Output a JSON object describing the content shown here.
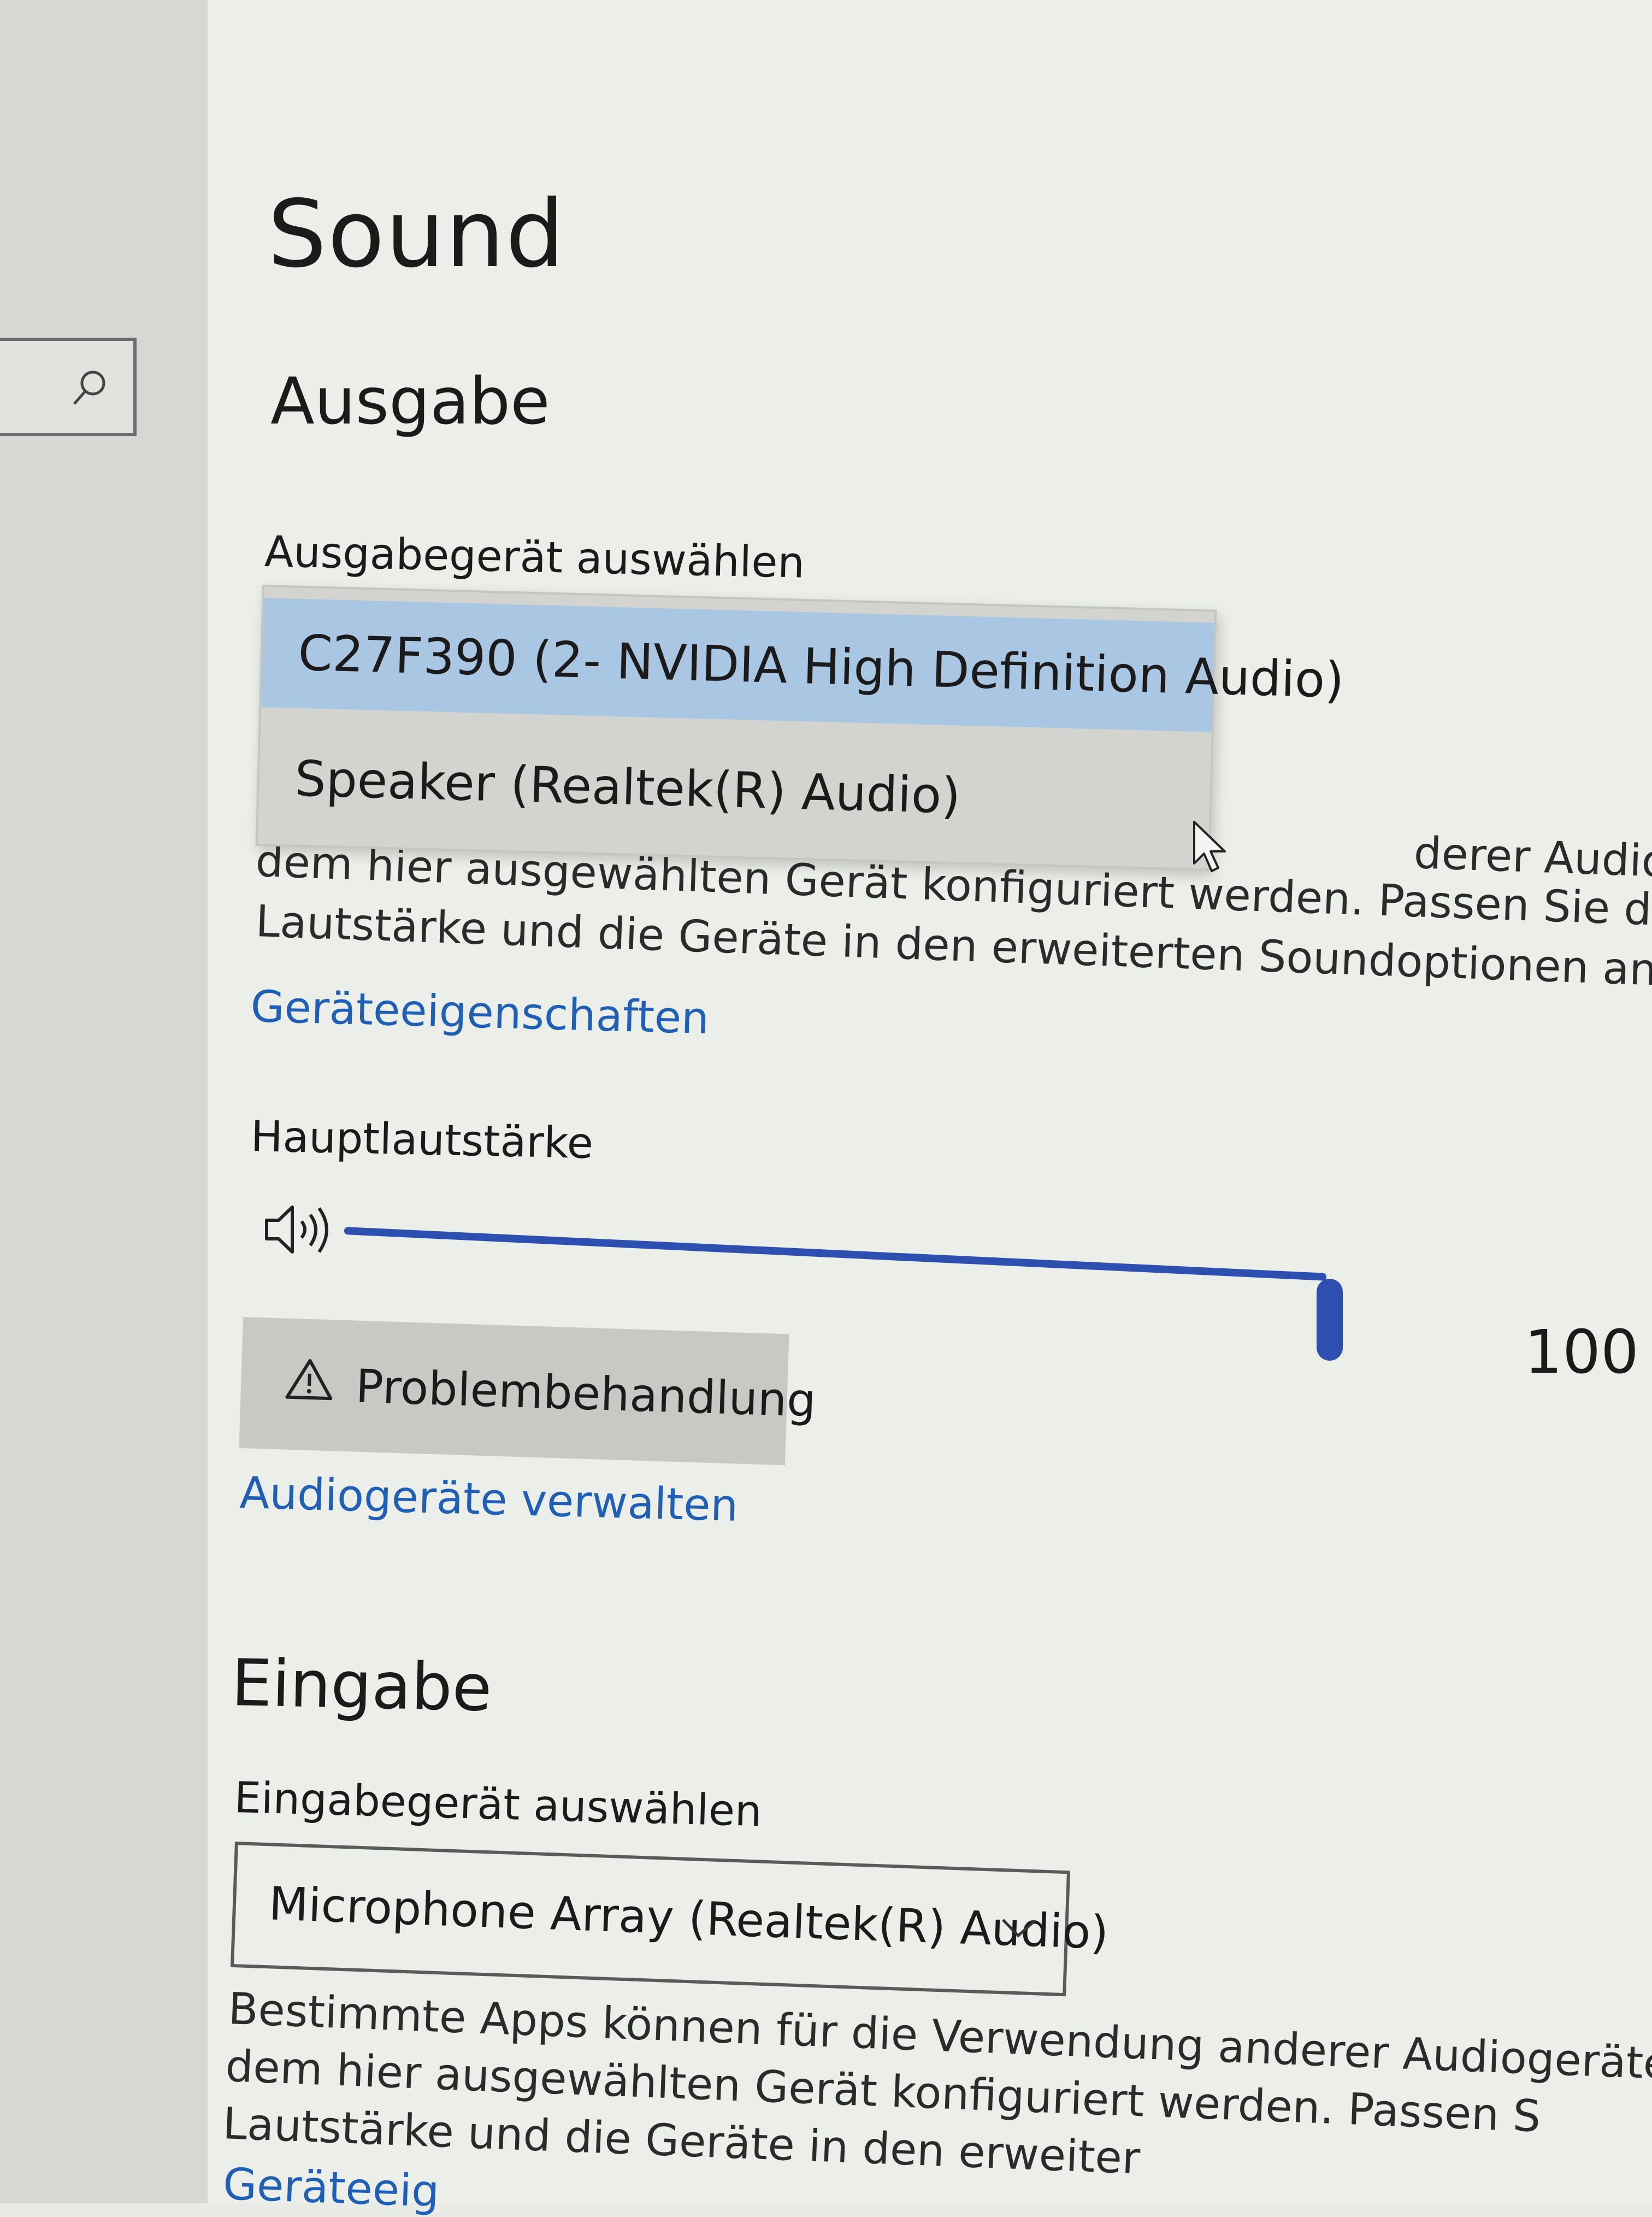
{
  "page": {
    "title": "Sound"
  },
  "output": {
    "heading": "Ausgabe",
    "device_label": "Ausgabegerät auswählen",
    "devices": [
      "C27F390 (2- NVIDIA High Definition Audio)",
      "Speaker (Realtek(R) Audio)"
    ],
    "description_lines": [
      "derer Audiogeräte a",
      "dem hier ausgewählten Gerät konfiguriert werden. Passen Sie die Ap",
      "Lautstärke und die Geräte in den erweiterten Soundoptionen an."
    ],
    "properties_link": "Geräteeigenschaften",
    "volume_label": "Hauptlautstärke",
    "volume_value": "100",
    "volume_level": 100,
    "troubleshoot_label": "Problembehandlung",
    "manage_link": "Audiogeräte verwalten"
  },
  "input": {
    "heading": "Eingabe",
    "device_label": "Eingabegerät auswählen",
    "selected_device": "Microphone Array (Realtek(R) Audio)",
    "description_lines": [
      "Bestimmte Apps können für die Verwendung anderer Audiogeräte als",
      "dem hier ausgewählten Gerät konfiguriert werden. Passen S",
      "Lautstärke und die Geräte in den erweiter"
    ],
    "properties_link": "Geräteeig"
  },
  "colors": {
    "accent": "#2d4fb0",
    "link": "#1f5fb5",
    "selection": "#a9c6e2"
  },
  "icons": {
    "search": "search-icon",
    "speaker": "speaker-icon",
    "warning": "warning-icon",
    "chevron": "chevron-down-icon",
    "cursor": "mouse-cursor-icon"
  }
}
